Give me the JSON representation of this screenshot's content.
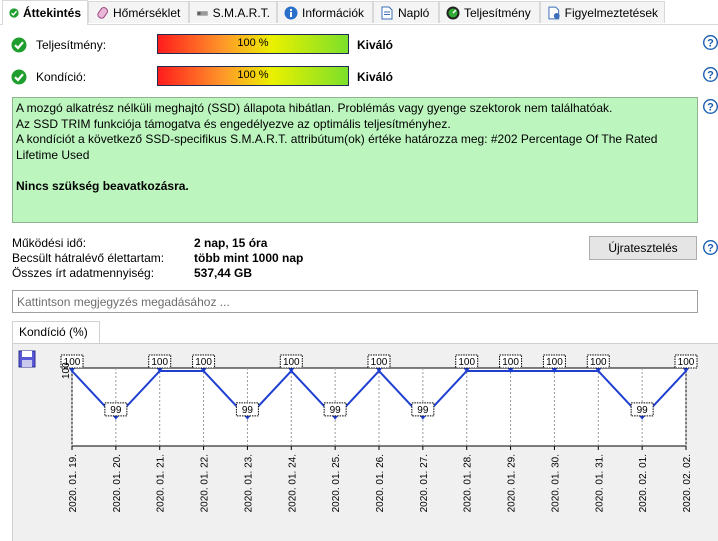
{
  "tabs": [
    {
      "label": "Áttekintés",
      "icon": "check-circle-icon",
      "active": true
    },
    {
      "label": "Hőmérséklet",
      "icon": "thermometer-icon",
      "active": false
    },
    {
      "label": "S.M.A.R.T.",
      "icon": "drive-icon",
      "active": false
    },
    {
      "label": "Információk",
      "icon": "info-icon",
      "active": false
    },
    {
      "label": "Napló",
      "icon": "document-icon",
      "active": false
    },
    {
      "label": "Teljesítmény",
      "icon": "gauge-icon",
      "active": false
    },
    {
      "label": "Figyelmeztetések",
      "icon": "alert-document-icon",
      "active": false
    }
  ],
  "performance": {
    "label": "Teljesítmény:",
    "percent_text": "100 %",
    "percent": 100,
    "status": "Kiváló"
  },
  "health": {
    "label": "Kondíció:",
    "percent_text": "100 %",
    "percent": 100,
    "status": "Kiváló"
  },
  "info": {
    "line1": "A mozgó alkatrész nélküli meghajtó (SSD) állapota hibátlan. Problémás vagy gyenge szektorok nem találhatóak.",
    "line2": "Az SSD TRIM funkciója támogatva és engedélyezve az optimális teljesítményhez.",
    "line3": "A kondíciót a következő SSD-specifikus S.M.A.R.T. attribútum(ok) értéke határozza meg:  #202 Percentage Of The Rated Lifetime Used",
    "action": "Nincs szükség beavatkozásra."
  },
  "stats": {
    "uptime_label": "Működési idő:",
    "uptime_value": "2 nap, 15 óra",
    "remaining_label": "Becsült hátralévő élettartam:",
    "remaining_value": "több mint 1000 nap",
    "written_label": "Összes írt adatmennyiség:",
    "written_value": "537,44 GB"
  },
  "retest_label": "Újratesztelés",
  "note_placeholder": "Kattintson megjegyzés megadásához ...",
  "chart_tab_label": "Kondíció  (%)",
  "colors": {
    "ok_green": "#1e9e2e",
    "info_bg": "#bdf5bf",
    "line": "#1f3fd1",
    "help_blue": "#1a5fb4"
  },
  "chart_data": {
    "type": "line",
    "title": "Kondíció  (%)",
    "y_tick": "100",
    "ylim": [
      98.4,
      100
    ],
    "grid": true,
    "categories": [
      "2020. 01. 19.",
      "2020. 01. 20.",
      "2020. 01. 21.",
      "2020. 01. 22.",
      "2020. 01. 23.",
      "2020. 01. 24.",
      "2020. 01. 25.",
      "2020. 01. 26.",
      "2020. 01. 27.",
      "2020. 01. 28.",
      "2020. 01. 29.",
      "2020. 01. 30.",
      "2020. 01. 31.",
      "2020. 02. 01.",
      "2020. 02. 02."
    ],
    "x": [
      0,
      1,
      2,
      3,
      4,
      5,
      6,
      7,
      8,
      9,
      10,
      11,
      12,
      13,
      14
    ],
    "points": [
      {
        "x": 0,
        "y": 100
      },
      {
        "x": 1,
        "y": 99
      },
      {
        "x": 2,
        "y": 100
      },
      {
        "x": 3,
        "y": 100
      },
      {
        "x": 4,
        "y": 99
      },
      {
        "x": 5,
        "y": 100
      },
      {
        "x": 6,
        "y": 99
      },
      {
        "x": 7,
        "y": 100
      },
      {
        "x": 8,
        "y": 99
      },
      {
        "x": 9,
        "y": 100
      },
      {
        "x": 10,
        "y": 100
      },
      {
        "x": 11,
        "y": 100
      },
      {
        "x": 12,
        "y": 100
      },
      {
        "x": 13,
        "y": 99
      },
      {
        "x": 14,
        "y": 100
      }
    ]
  }
}
